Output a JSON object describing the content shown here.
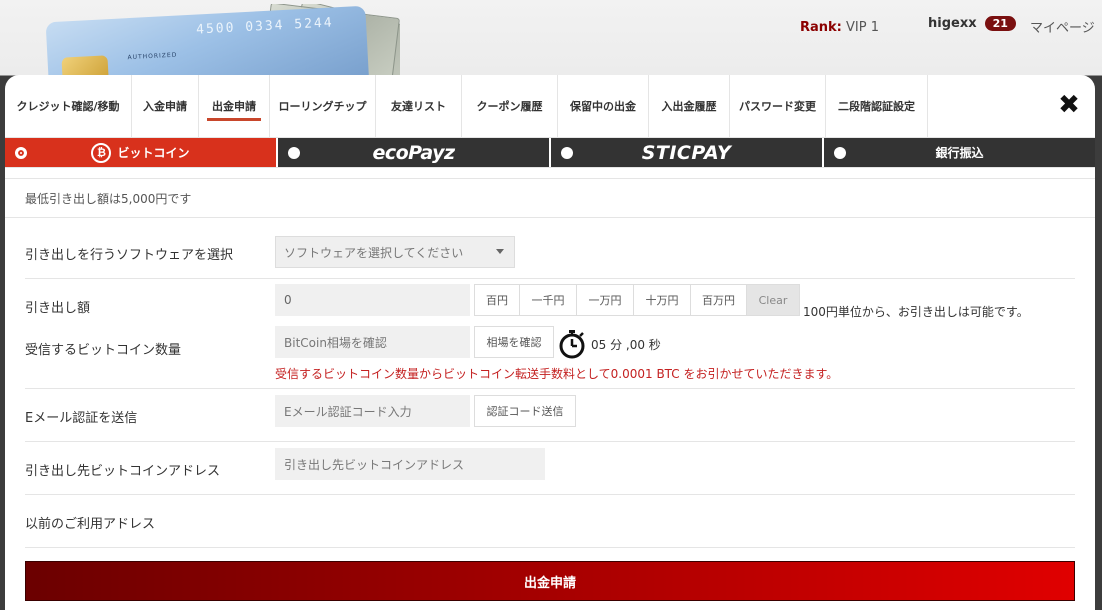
{
  "header": {
    "rank_label": "Rank:",
    "rank_value": "VIP 1",
    "username": "higexx",
    "notification_count": "21",
    "mypage_label": "マイページ",
    "card_number": "4500 0334 5244",
    "card_auth": "AUTHORIZED"
  },
  "menu": {
    "tabs": [
      {
        "label": "クレジット確認/移動"
      },
      {
        "label": "入金申請"
      },
      {
        "label": "出金申請"
      },
      {
        "label": "ローリングチップ"
      },
      {
        "label": "友達リスト"
      },
      {
        "label": "クーポン履歴"
      },
      {
        "label": "保留中の出金"
      },
      {
        "label": "入出金履歴"
      },
      {
        "label": "パスワード変更"
      },
      {
        "label": "二段階認証設定"
      }
    ],
    "active_index": 2
  },
  "payment_methods": {
    "bitcoin": "ビットコイン",
    "bitcoin_symbol": "₿",
    "ecopayz": "ecoPayz",
    "sticpay": "STICPAY",
    "bank": "銀行振込",
    "active_color": "#d8311c"
  },
  "notice": "最低引き出し額は5,000円です",
  "form": {
    "software_label": "引き出しを行うソフトウェアを選択",
    "software_placeholder": "ソフトウェアを選択してください",
    "amount_label": "引き出し額",
    "amount_value": "0",
    "amount_buttons": [
      "百円",
      "一千円",
      "一万円",
      "十万円",
      "百万円"
    ],
    "clear_label": "Clear",
    "amount_note": "100円単位から、お引き出しは可能です。",
    "btc_label": "受信するビットコイン数量",
    "btc_placeholder": "BitCoin相場を確認",
    "btc_check_button": "相場を確認",
    "timer_text": "05 分 ,00 秒",
    "btc_warning": "受信するビットコイン数量からビットコイン転送手数料として0.0001 BTC をお引かせていただきます。",
    "email_label": "Eメール認証を送信",
    "email_placeholder": "Eメール認証コード入力",
    "email_send_button": "認証コード送信",
    "address_label": "引き出し先ビットコインアドレス",
    "address_placeholder": "引き出し先ビットコインアドレス",
    "previous_label": "以前のご利用アドレス",
    "submit_label": "出金申請"
  }
}
